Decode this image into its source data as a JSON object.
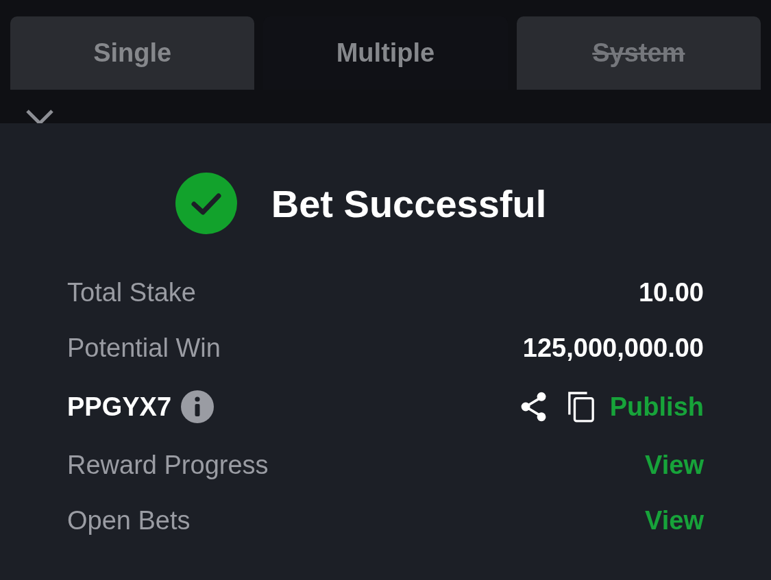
{
  "tabs": [
    {
      "label": "Single",
      "selected": false,
      "disabled": false
    },
    {
      "label": "Multiple",
      "selected": true,
      "disabled": false
    },
    {
      "label": "System",
      "selected": false,
      "disabled": true
    }
  ],
  "result": {
    "title": "Bet Successful",
    "success": true
  },
  "rows": [
    {
      "kind": "value",
      "label": "Total Stake",
      "value": "10.00"
    },
    {
      "kind": "value",
      "label": "Potential Win",
      "value": "125,000,000.00"
    },
    {
      "kind": "code",
      "label": "PPGYX7",
      "action": "Publish"
    },
    {
      "kind": "link",
      "label": "Reward Progress",
      "action": "View"
    },
    {
      "kind": "link",
      "label": "Open Bets",
      "action": "View"
    }
  ]
}
